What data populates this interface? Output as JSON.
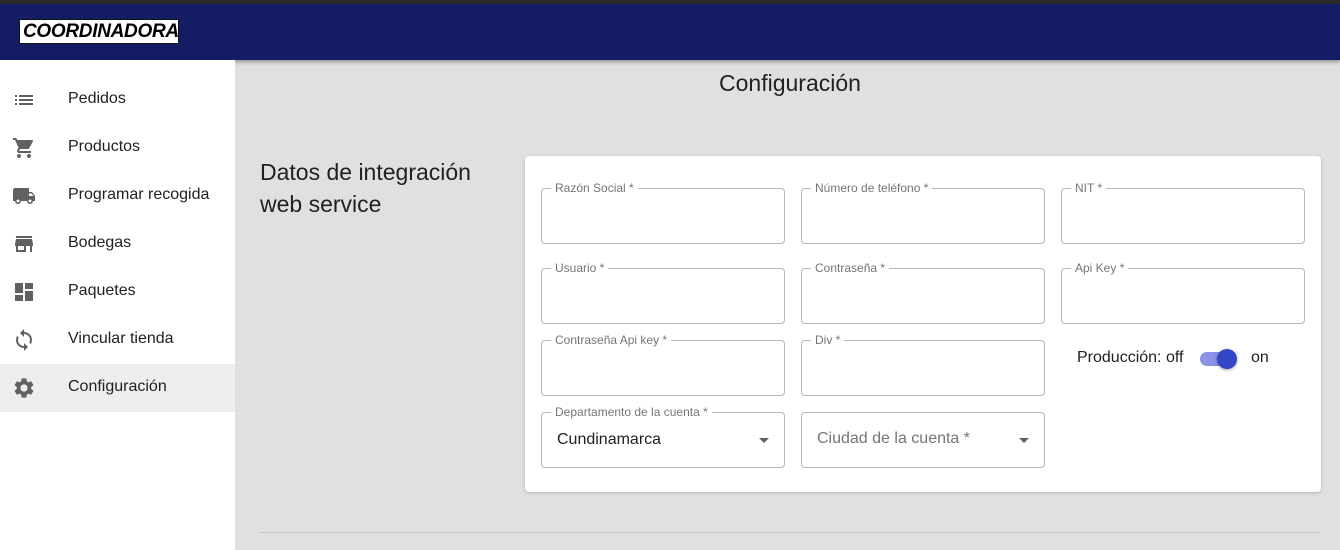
{
  "brand": {
    "logo_text": "COORDINADORA"
  },
  "sidebar": {
    "items": [
      {
        "label": "Pedidos",
        "icon": "list-icon"
      },
      {
        "label": "Productos",
        "icon": "cart-icon"
      },
      {
        "label": "Programar recogida",
        "icon": "truck-icon"
      },
      {
        "label": "Bodegas",
        "icon": "store-icon"
      },
      {
        "label": "Paquetes",
        "icon": "dashboard-icon"
      },
      {
        "label": "Vincular tienda",
        "icon": "sync-icon"
      },
      {
        "label": "Configuración",
        "icon": "gear-icon",
        "active": true
      }
    ]
  },
  "page": {
    "title": "Configuración"
  },
  "section": {
    "title": "Datos de integración web service"
  },
  "form": {
    "razon_social": {
      "label": "Razón Social *",
      "value": ""
    },
    "telefono": {
      "label": "Número de teléfono *",
      "value": ""
    },
    "nit": {
      "label": "NIT *",
      "value": ""
    },
    "usuario": {
      "label": "Usuario *",
      "value": ""
    },
    "contrasena": {
      "label": "Contraseña *",
      "value": ""
    },
    "api_key": {
      "label": "Api Key *",
      "value": ""
    },
    "contrasena_api_key": {
      "label": "Contraseña Api key *",
      "value": ""
    },
    "div": {
      "label": "Div *",
      "value": ""
    },
    "departamento": {
      "label": "Departamento de la cuenta *",
      "value": "Cundinamarca"
    },
    "ciudad": {
      "placeholder": "Ciudad de la cuenta *",
      "value": ""
    },
    "produccion": {
      "off_label": "Producción: off",
      "on_label": "on",
      "enabled": true
    }
  },
  "colors": {
    "appbar": "#141c64",
    "toggle_thumb": "#3346c8",
    "toggle_track": "#8a92e6",
    "page_background": "#e0e0e0"
  }
}
